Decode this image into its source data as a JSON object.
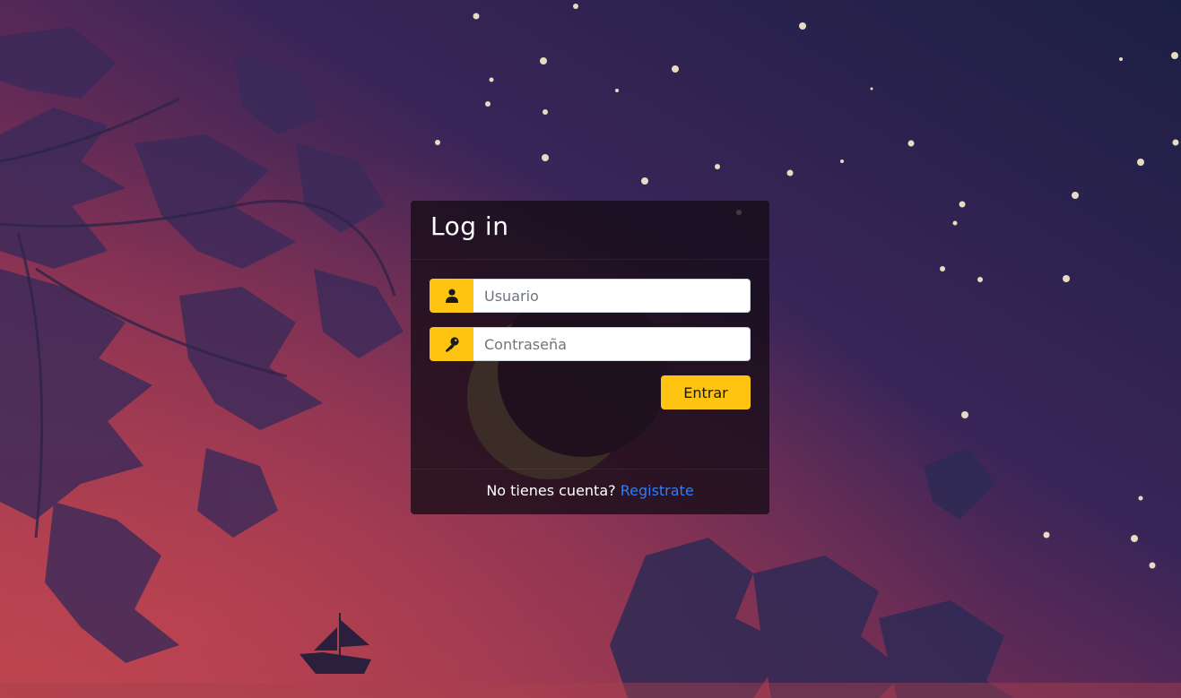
{
  "login": {
    "title": "Log in",
    "username_placeholder": "Usuario",
    "password_placeholder": "Contraseña",
    "submit_label": "Entrar",
    "footer_text": "No tienes cuenta?",
    "register_link": "Registrate"
  },
  "icons": {
    "username": "user-icon",
    "password": "key-icon"
  },
  "colors": {
    "accent": "#ffc312",
    "link": "#2f7ef7",
    "card_background": "#140c16",
    "sky_top": "#1d1f45",
    "sky_bottom": "#b4434e"
  }
}
